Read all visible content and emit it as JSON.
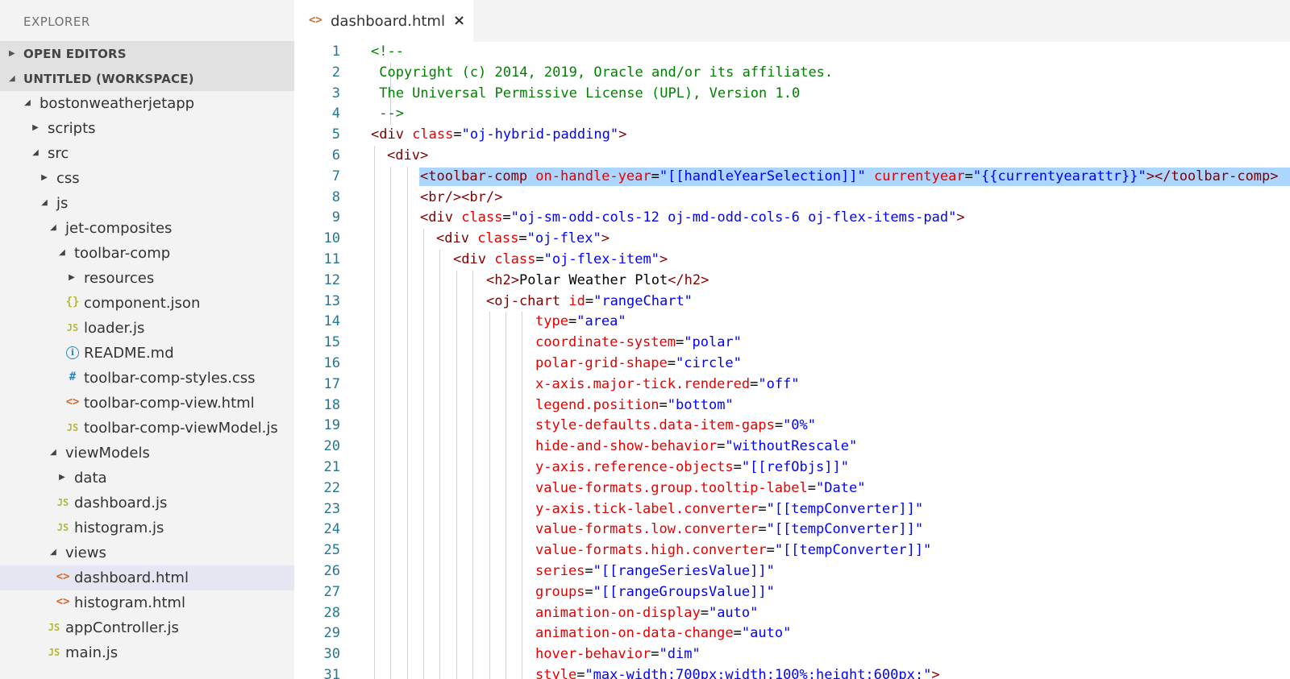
{
  "sidebar": {
    "title": "EXPLORER",
    "sections": [
      {
        "label": "OPEN EDITORS",
        "expanded": false
      },
      {
        "label": "UNTITLED (WORKSPACE)",
        "expanded": true
      }
    ],
    "tree": [
      {
        "label": "bostonweatherjetapp",
        "kind": "folder",
        "expanded": true,
        "level": 0,
        "name": "tree-folder-bostonweatherjetapp"
      },
      {
        "label": "scripts",
        "kind": "folder",
        "expanded": false,
        "level": 1,
        "name": "tree-folder-scripts"
      },
      {
        "label": "src",
        "kind": "folder",
        "expanded": true,
        "level": 1,
        "name": "tree-folder-src"
      },
      {
        "label": "css",
        "kind": "folder",
        "expanded": false,
        "level": 2,
        "name": "tree-folder-css"
      },
      {
        "label": "js",
        "kind": "folder",
        "expanded": true,
        "level": 2,
        "name": "tree-folder-js"
      },
      {
        "label": "jet-composites",
        "kind": "folder",
        "expanded": true,
        "level": 3,
        "name": "tree-folder-jet-composites"
      },
      {
        "label": "toolbar-comp",
        "kind": "folder",
        "expanded": true,
        "level": 4,
        "name": "tree-folder-toolbar-comp"
      },
      {
        "label": "resources",
        "kind": "folder",
        "expanded": false,
        "level": 5,
        "name": "tree-folder-resources"
      },
      {
        "label": "component.json",
        "kind": "json",
        "level": 5,
        "name": "tree-file-component-json"
      },
      {
        "label": "loader.js",
        "kind": "js",
        "level": 5,
        "name": "tree-file-loader-js"
      },
      {
        "label": "README.md",
        "kind": "info",
        "level": 5,
        "name": "tree-file-readme-md"
      },
      {
        "label": "toolbar-comp-styles.css",
        "kind": "css",
        "level": 5,
        "name": "tree-file-toolbar-comp-styles-css"
      },
      {
        "label": "toolbar-comp-view.html",
        "kind": "html",
        "level": 5,
        "name": "tree-file-toolbar-comp-view-html"
      },
      {
        "label": "toolbar-comp-viewModel.js",
        "kind": "js",
        "level": 5,
        "name": "tree-file-toolbar-comp-viewmodel-js"
      },
      {
        "label": "viewModels",
        "kind": "folder",
        "expanded": true,
        "level": 3,
        "name": "tree-folder-viewmodels"
      },
      {
        "label": "data",
        "kind": "folder",
        "expanded": false,
        "level": 4,
        "name": "tree-folder-data"
      },
      {
        "label": "dashboard.js",
        "kind": "js",
        "level": 4,
        "name": "tree-file-dashboard-js"
      },
      {
        "label": "histogram.js",
        "kind": "js",
        "level": 4,
        "name": "tree-file-histogram-js"
      },
      {
        "label": "views",
        "kind": "folder",
        "expanded": true,
        "level": 3,
        "name": "tree-folder-views"
      },
      {
        "label": "dashboard.html",
        "kind": "html",
        "level": 4,
        "selected": true,
        "name": "tree-file-dashboard-html"
      },
      {
        "label": "histogram.html",
        "kind": "html",
        "level": 4,
        "name": "tree-file-histogram-html"
      },
      {
        "label": "appController.js",
        "kind": "js",
        "level": 3,
        "name": "tree-file-appcontroller-js"
      },
      {
        "label": "main.js",
        "kind": "js",
        "level": 3,
        "name": "tree-file-main-js"
      }
    ]
  },
  "icons": {
    "html": "<>",
    "js": "JS",
    "json": "{}",
    "css": "#",
    "info": "i",
    "collapsed": "▶",
    "expanded": "◢",
    "close": "×"
  },
  "editor": {
    "tab": {
      "label": "dashboard.html",
      "icon": "html-file-icon"
    },
    "highlighted_line": 7,
    "lines": [
      {
        "n": "1",
        "indent": 0,
        "tokens": [
          {
            "t": "com",
            "v": "<!--"
          }
        ]
      },
      {
        "n": "2",
        "indent": 0,
        "tokens": [
          {
            "t": "com",
            "v": " Copyright (c) 2014, 2019, Oracle and/or its affiliates."
          }
        ]
      },
      {
        "n": "3",
        "indent": 0,
        "tokens": [
          {
            "t": "com",
            "v": " The Universal Permissive License (UPL), Version 1.0"
          }
        ]
      },
      {
        "n": "4",
        "indent": 0,
        "tokens": [
          {
            "t": "com",
            "v": " -->"
          }
        ]
      },
      {
        "n": "5",
        "indent": 0,
        "tokens": [
          {
            "t": "tag",
            "v": "<div "
          },
          {
            "t": "attr",
            "v": "class"
          },
          {
            "t": "txt",
            "v": "="
          },
          {
            "t": "val",
            "v": "\"oj-hybrid-padding\""
          },
          {
            "t": "tag",
            "v": ">"
          }
        ]
      },
      {
        "n": "6",
        "indent": 1,
        "tokens": [
          {
            "t": "tag",
            "v": "<div>"
          }
        ]
      },
      {
        "n": "7",
        "indent": 3,
        "tokens": [
          {
            "t": "tag",
            "v": "<toolbar-comp "
          },
          {
            "t": "attr",
            "v": "on-handle-year"
          },
          {
            "t": "txt",
            "v": "="
          },
          {
            "t": "val",
            "v": "\"[[handleYearSelection]]\""
          },
          {
            "t": "txt",
            "v": " "
          },
          {
            "t": "attr",
            "v": "currentyear"
          },
          {
            "t": "txt",
            "v": "="
          },
          {
            "t": "val",
            "v": "\"{{currentyearattr}}\""
          },
          {
            "t": "tag",
            "v": "></toolbar-comp>"
          }
        ]
      },
      {
        "n": "8",
        "indent": 3,
        "tokens": [
          {
            "t": "tag",
            "v": "<br/><br/>"
          }
        ]
      },
      {
        "n": "9",
        "indent": 3,
        "tokens": [
          {
            "t": "tag",
            "v": "<div "
          },
          {
            "t": "attr",
            "v": "class"
          },
          {
            "t": "txt",
            "v": "="
          },
          {
            "t": "val",
            "v": "\"oj-sm-odd-cols-12 oj-md-odd-cols-6 oj-flex-items-pad\""
          },
          {
            "t": "tag",
            "v": ">"
          }
        ]
      },
      {
        "n": "10",
        "indent": 4,
        "tokens": [
          {
            "t": "tag",
            "v": "<div "
          },
          {
            "t": "attr",
            "v": "class"
          },
          {
            "t": "txt",
            "v": "="
          },
          {
            "t": "val",
            "v": "\"oj-flex\""
          },
          {
            "t": "tag",
            "v": ">"
          }
        ]
      },
      {
        "n": "11",
        "indent": 5,
        "tokens": [
          {
            "t": "tag",
            "v": "<div "
          },
          {
            "t": "attr",
            "v": "class"
          },
          {
            "t": "txt",
            "v": "="
          },
          {
            "t": "val",
            "v": "\"oj-flex-item\""
          },
          {
            "t": "tag",
            "v": ">"
          }
        ]
      },
      {
        "n": "12",
        "indent": 7,
        "tokens": [
          {
            "t": "tag",
            "v": "<h2>"
          },
          {
            "t": "txt",
            "v": "Polar Weather Plot"
          },
          {
            "t": "tag",
            "v": "</h2>"
          }
        ]
      },
      {
        "n": "13",
        "indent": 7,
        "tokens": [
          {
            "t": "tag",
            "v": "<oj-chart "
          },
          {
            "t": "attr",
            "v": "id"
          },
          {
            "t": "txt",
            "v": "="
          },
          {
            "t": "val",
            "v": "\"rangeChart\""
          }
        ]
      },
      {
        "n": "14",
        "indent": 10,
        "tokens": [
          {
            "t": "attr",
            "v": "type"
          },
          {
            "t": "txt",
            "v": "="
          },
          {
            "t": "val",
            "v": "\"area\""
          }
        ]
      },
      {
        "n": "15",
        "indent": 10,
        "tokens": [
          {
            "t": "attr",
            "v": "coordinate-system"
          },
          {
            "t": "txt",
            "v": "="
          },
          {
            "t": "val",
            "v": "\"polar\""
          }
        ]
      },
      {
        "n": "16",
        "indent": 10,
        "tokens": [
          {
            "t": "attr",
            "v": "polar-grid-shape"
          },
          {
            "t": "txt",
            "v": "="
          },
          {
            "t": "val",
            "v": "\"circle\""
          }
        ]
      },
      {
        "n": "17",
        "indent": 10,
        "tokens": [
          {
            "t": "attr",
            "v": "x-axis.major-tick.rendered"
          },
          {
            "t": "txt",
            "v": "="
          },
          {
            "t": "val",
            "v": "\"off\""
          }
        ]
      },
      {
        "n": "18",
        "indent": 10,
        "tokens": [
          {
            "t": "attr",
            "v": "legend.position"
          },
          {
            "t": "txt",
            "v": "="
          },
          {
            "t": "val",
            "v": "\"bottom\""
          }
        ]
      },
      {
        "n": "19",
        "indent": 10,
        "tokens": [
          {
            "t": "attr",
            "v": "style-defaults.data-item-gaps"
          },
          {
            "t": "txt",
            "v": "="
          },
          {
            "t": "val",
            "v": "\"0%\""
          }
        ]
      },
      {
        "n": "20",
        "indent": 10,
        "tokens": [
          {
            "t": "attr",
            "v": "hide-and-show-behavior"
          },
          {
            "t": "txt",
            "v": "="
          },
          {
            "t": "val",
            "v": "\"withoutRescale\""
          }
        ]
      },
      {
        "n": "21",
        "indent": 10,
        "tokens": [
          {
            "t": "attr",
            "v": "y-axis.reference-objects"
          },
          {
            "t": "txt",
            "v": "="
          },
          {
            "t": "val",
            "v": "\"[[refObjs]]\""
          }
        ]
      },
      {
        "n": "22",
        "indent": 10,
        "tokens": [
          {
            "t": "attr",
            "v": "value-formats.group.tooltip-label"
          },
          {
            "t": "txt",
            "v": "="
          },
          {
            "t": "val",
            "v": "\"Date\""
          }
        ]
      },
      {
        "n": "23",
        "indent": 10,
        "tokens": [
          {
            "t": "attr",
            "v": "y-axis.tick-label.converter"
          },
          {
            "t": "txt",
            "v": "="
          },
          {
            "t": "val",
            "v": "\"[[tempConverter]]\""
          }
        ]
      },
      {
        "n": "24",
        "indent": 10,
        "tokens": [
          {
            "t": "attr",
            "v": "value-formats.low.converter"
          },
          {
            "t": "txt",
            "v": "="
          },
          {
            "t": "val",
            "v": "\"[[tempConverter]]\""
          }
        ]
      },
      {
        "n": "25",
        "indent": 10,
        "tokens": [
          {
            "t": "attr",
            "v": "value-formats.high.converter"
          },
          {
            "t": "txt",
            "v": "="
          },
          {
            "t": "val",
            "v": "\"[[tempConverter]]\""
          }
        ]
      },
      {
        "n": "26",
        "indent": 10,
        "tokens": [
          {
            "t": "attr",
            "v": "series"
          },
          {
            "t": "txt",
            "v": "="
          },
          {
            "t": "val",
            "v": "\"[[rangeSeriesValue]]\""
          }
        ]
      },
      {
        "n": "27",
        "indent": 10,
        "tokens": [
          {
            "t": "attr",
            "v": "groups"
          },
          {
            "t": "txt",
            "v": "="
          },
          {
            "t": "val",
            "v": "\"[[rangeGroupsValue]]\""
          }
        ]
      },
      {
        "n": "28",
        "indent": 10,
        "tokens": [
          {
            "t": "attr",
            "v": "animation-on-display"
          },
          {
            "t": "txt",
            "v": "="
          },
          {
            "t": "val",
            "v": "\"auto\""
          }
        ]
      },
      {
        "n": "29",
        "indent": 10,
        "tokens": [
          {
            "t": "attr",
            "v": "animation-on-data-change"
          },
          {
            "t": "txt",
            "v": "="
          },
          {
            "t": "val",
            "v": "\"auto\""
          }
        ]
      },
      {
        "n": "30",
        "indent": 10,
        "tokens": [
          {
            "t": "attr",
            "v": "hover-behavior"
          },
          {
            "t": "txt",
            "v": "="
          },
          {
            "t": "val",
            "v": "\"dim\""
          }
        ]
      },
      {
        "n": "31",
        "indent": 10,
        "tokens": [
          {
            "t": "attr",
            "v": "style"
          },
          {
            "t": "txt",
            "v": "="
          },
          {
            "t": "val",
            "v": "\"max-width:700px;width:100%;height:600px;\""
          },
          {
            "t": "tag",
            "v": ">"
          }
        ]
      }
    ]
  },
  "colors": {
    "comment": "#008000",
    "tag": "#800000",
    "attribute": "#e50000",
    "value": "#0000ff",
    "line_number": "#237893",
    "selection": "#add6ff"
  }
}
